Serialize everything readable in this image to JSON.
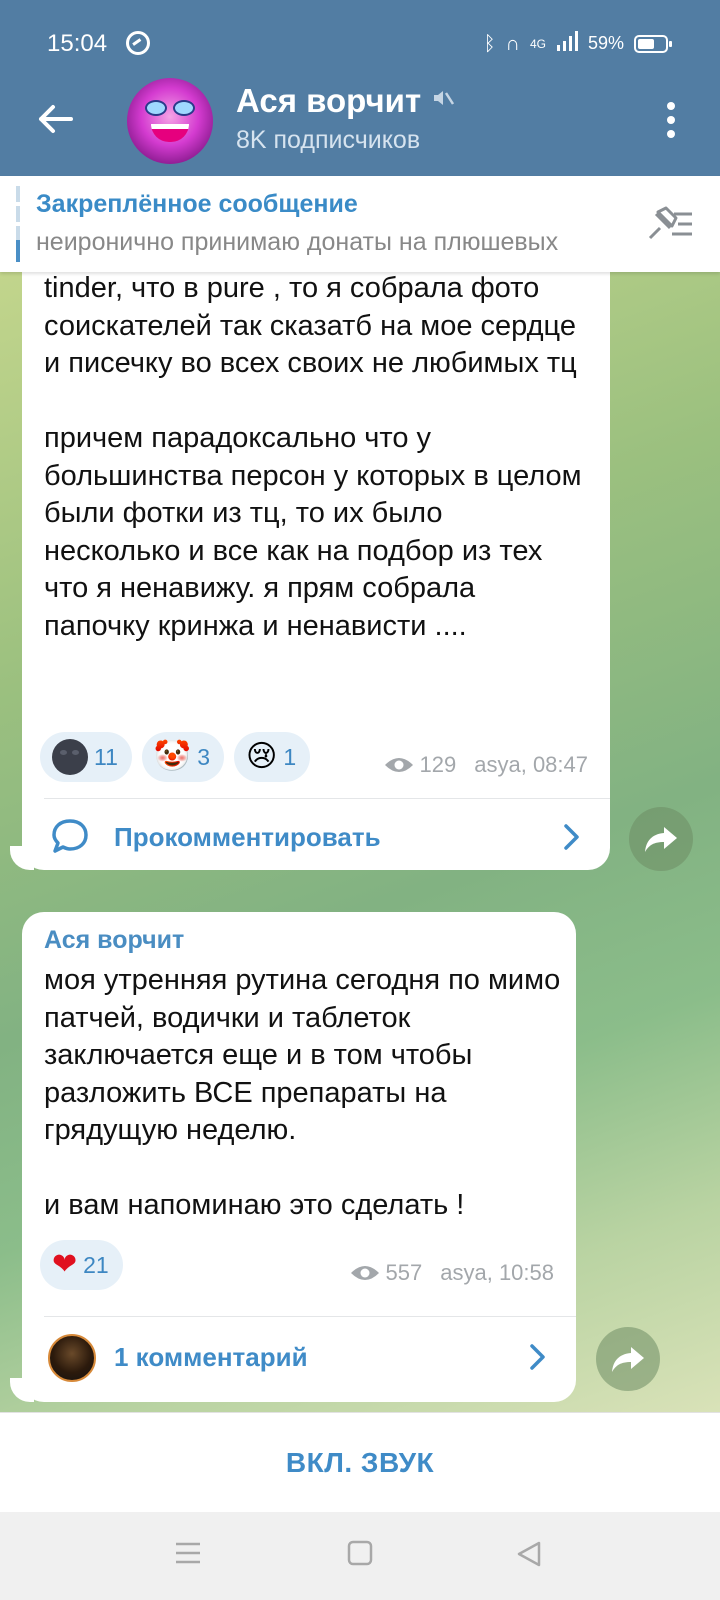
{
  "status_bar": {
    "time": "15:04",
    "network": "4G",
    "battery": "59%"
  },
  "header": {
    "channel_name": "Ася ворчит",
    "subscribers": "8K подписчиков"
  },
  "pinned": {
    "title": "Закреплённое сообщение",
    "text": "неиронично принимаю донаты на плюшевых"
  },
  "messages": [
    {
      "text": "tinder, что в pure , то я собрала фото соискателей так сказатб на мое сердце и писечку во всех своих не любимых тц\n\nпричем парадоксально что у большинства персон у которых в целом были фотки из тц, то их было несколько и все как на подбор из тех что я ненавижу. я прям собрала папочку кринжа и ненависти ....",
      "reactions": [
        {
          "emoji": "new-moon-face",
          "count": "11"
        },
        {
          "emoji": "🤡",
          "count": "3"
        },
        {
          "emoji": "😢",
          "count": "1"
        }
      ],
      "views": "129",
      "signature": "asya, 08:47",
      "comment_label": "Прокомментировать"
    },
    {
      "author": "Ася ворчит",
      "text": "моя утренняя рутина сегодня по мимо патчей, водички и таблеток заключается еще и в том чтобы разложить ВСЕ препараты на грядущую неделю.\n\nи вам напоминаю это сделать !",
      "reactions": [
        {
          "emoji": "❤",
          "count": "21"
        }
      ],
      "views": "557",
      "signature": "asya, 10:58",
      "comment_label": "1 комментарий"
    }
  ],
  "bottom": {
    "sound_button": "ВКЛ. ЗВУК"
  },
  "colors": {
    "header": "#527da3",
    "accent": "#3f8bc7",
    "reaction_bg": "#e6f0f8"
  }
}
